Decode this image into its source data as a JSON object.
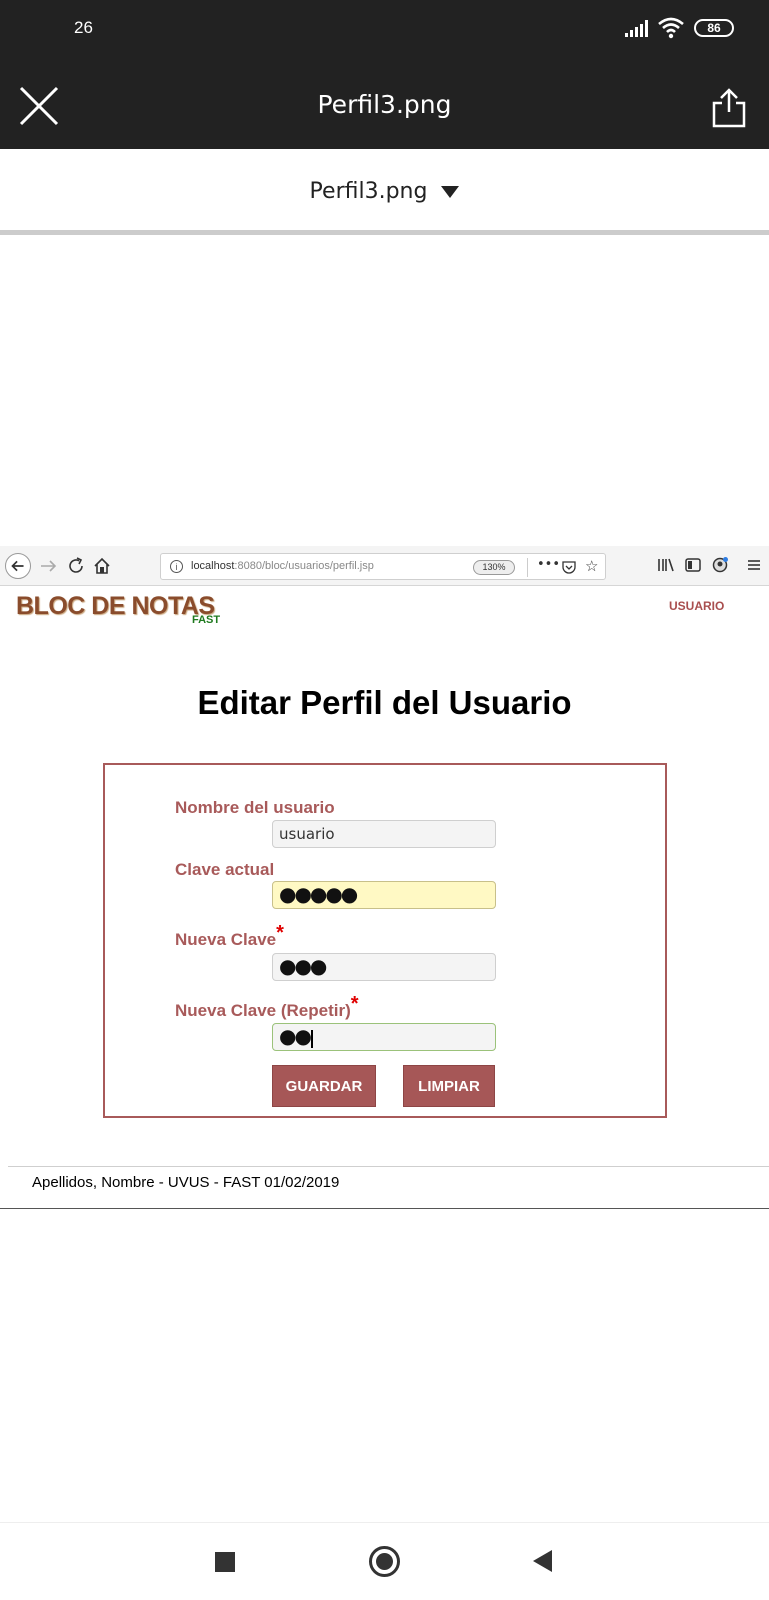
{
  "status_bar": {
    "time": "26",
    "battery": "86"
  },
  "viewer": {
    "title": "Perfil3.png",
    "file_selector": "Perfil3.png"
  },
  "browser": {
    "url_host": "localhost",
    "url_rest": ":8080/bloc/usuarios/perfil.jsp",
    "zoom": "130%",
    "more": "•••"
  },
  "page": {
    "logo": "BLOC DE NOTAS",
    "logo_sub": "FAST",
    "user_link": "USUARIO",
    "title": "Editar Perfil del Usuario",
    "form": {
      "username_label": "Nombre del usuario",
      "username_value": "usuario",
      "current_pw_label": "Clave actual",
      "current_pw_value": "●●●●●",
      "new_pw_label": "Nueva Clave",
      "new_pw_value": "●●●",
      "repeat_pw_label": "Nueva Clave (Repetir)",
      "repeat_pw_value": "●●",
      "required_mark": "*",
      "save_button": "GUARDAR",
      "clear_button": "LIMPIAR"
    },
    "footer": "Apellidos, Nombre - UVUS - FAST 01/02/2019"
  },
  "colors": {
    "accent": "#a85a5a",
    "dark_bar": "#222222",
    "required": "#e00000",
    "highlight_input": "#fff9c4"
  }
}
